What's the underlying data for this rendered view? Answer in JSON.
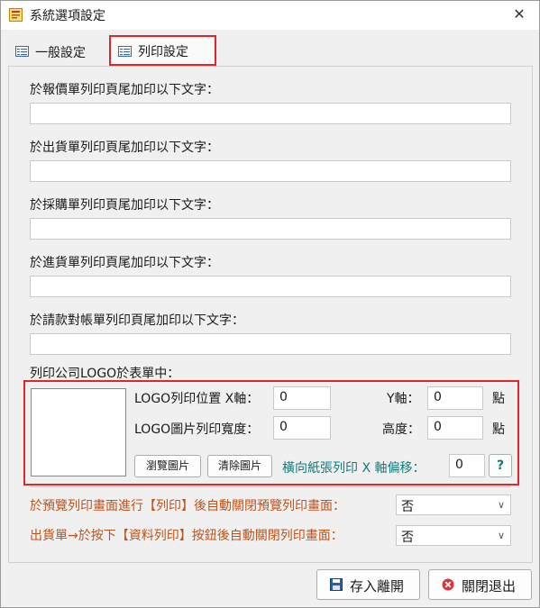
{
  "window": {
    "title": "系統選項設定",
    "close_glyph": "✕"
  },
  "tabs": [
    {
      "label": "一般設定",
      "icon": "list-icon"
    },
    {
      "label": "列印設定",
      "icon": "list-icon"
    }
  ],
  "footers": [
    {
      "label": "於報價單列印頁尾加印以下文字：",
      "value": ""
    },
    {
      "label": "於出貨單列印頁尾加印以下文字：",
      "value": ""
    },
    {
      "label": "於採購單列印頁尾加印以下文字：",
      "value": ""
    },
    {
      "label": "於進貨單列印頁尾加印以下文字：",
      "value": ""
    },
    {
      "label": "於請款對帳單列印頁尾加印以下文字：",
      "value": ""
    }
  ],
  "logo": {
    "section_label": "列印公司LOGO於表單中：",
    "pos_label": "LOGO列印位置 X軸：",
    "pos_x": "0",
    "y_label": "Y軸：",
    "pos_y": "0",
    "unit1": "點",
    "size_label": "LOGO圖片列印寬度：",
    "width": "0",
    "height_label": "高度：",
    "height": "0",
    "unit2": "點",
    "browse_button": "瀏覽圖片",
    "clear_button": "清除圖片",
    "offset_label": "橫向紙張列印 X 軸偏移：",
    "offset": "0",
    "help_button": "?"
  },
  "options": [
    {
      "label": "於預覽列印畫面進行【列印】後自動關閉預覽列印畫面：",
      "value": "否"
    },
    {
      "label": "出貨單→於按下【資料列印】按鈕後自動關閉列印畫面：",
      "value": "否"
    }
  ],
  "buttons": {
    "save": "存入離開",
    "exit": "關閉退出"
  },
  "colors": {
    "highlight": "#e0252b",
    "teal": "#0f7c7a",
    "orange": "#c0521a"
  }
}
